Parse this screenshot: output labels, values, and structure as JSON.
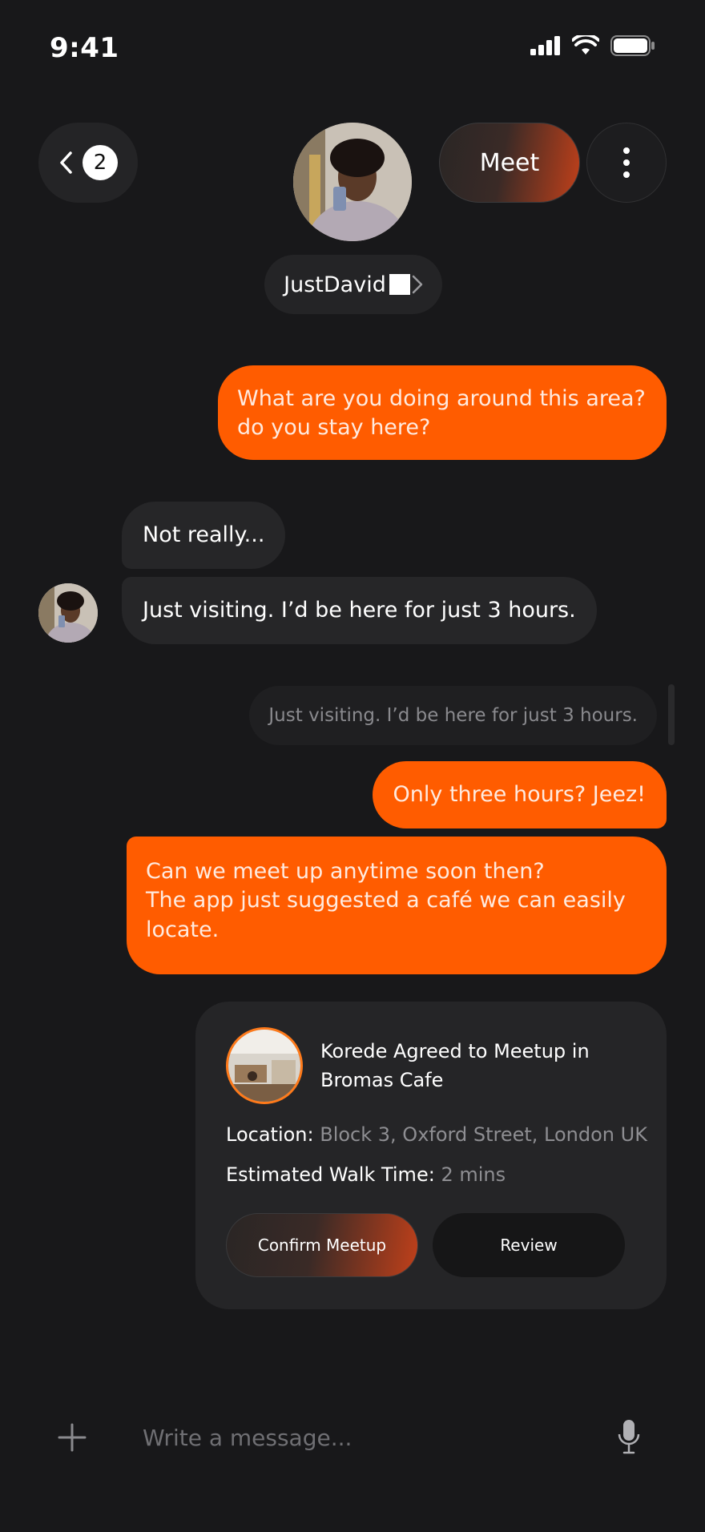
{
  "status_bar": {
    "time": "9:41"
  },
  "header": {
    "back_count": "2",
    "meet_label": "Meet",
    "contact_name": "JustDavid"
  },
  "messages": [
    {
      "direction": "out",
      "text": "What are you doing around this area? do you stay here?"
    },
    {
      "direction": "in",
      "text": "Not really..."
    },
    {
      "direction": "in",
      "text": "Just visiting. I’d be here for just 3 hours."
    },
    {
      "direction": "reply-preview",
      "text": "Just visiting. I’d be here for just 3 hours."
    },
    {
      "direction": "out",
      "text": "Only three hours? Jeez!"
    },
    {
      "direction": "out",
      "lines": [
        "Can we meet up anytime soon then?",
        "The app just suggested a café we can easily locate."
      ]
    }
  ],
  "meetup_card": {
    "title": "Korede Agreed to Meetup in Bromas Cafe",
    "location_label": "Location:",
    "location_value": "Block 3, Oxford Street, London UK",
    "walk_label": "Estimated Walk Time:",
    "walk_value": "2 mins",
    "confirm_label": "Confirm Meetup",
    "review_label": "Review"
  },
  "composer": {
    "placeholder": "Write a message..."
  },
  "colors": {
    "accent": "#ff5c00",
    "background": "#18181a",
    "bubble_in": "#262628"
  }
}
